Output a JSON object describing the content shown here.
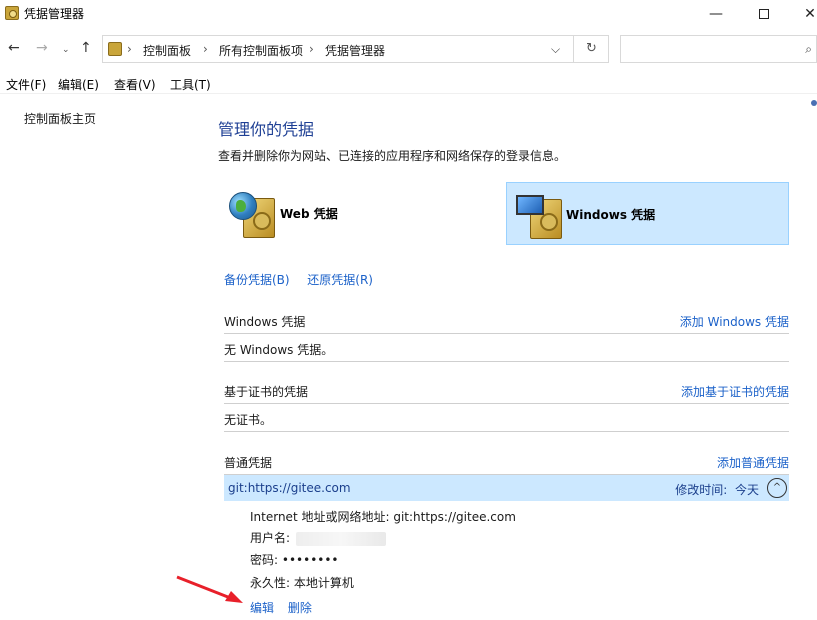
{
  "window": {
    "title": "凭据管理器",
    "minimize_label": "—",
    "close_label": "✕"
  },
  "nav": {
    "back_label": "←",
    "forward_label": "→",
    "recent_label": "⌄",
    "up_label": "↑",
    "breadcrumbs": [
      "控制面板",
      "所有控制面板项",
      "凭据管理器"
    ],
    "separator": "›",
    "dropdown_label": "⌵",
    "refresh_label": "↻",
    "search_placeholder": "",
    "search_label": "⌕"
  },
  "menu": [
    "文件(F)",
    "编辑(E)",
    "查看(V)",
    "工具(T)"
  ],
  "sidebar": {
    "home_link": "控制面板主页"
  },
  "main": {
    "title": "管理你的凭据",
    "description": "查看并删除你为网站、已连接的应用程序和网络保存的登录信息。",
    "cred_types": {
      "web": "Web 凭据",
      "windows": "Windows 凭据",
      "selected": "windows"
    },
    "backup_link": "备份凭据(B)",
    "restore_link": "还原凭据(R)",
    "sections": {
      "windows": {
        "title": "Windows 凭据",
        "action": "添加 Windows 凭据",
        "empty": "无 Windows 凭据。"
      },
      "certificate": {
        "title": "基于证书的凭据",
        "action": "添加基于证书的凭据",
        "empty": "无证书。"
      },
      "generic": {
        "title": "普通凭据",
        "action": "添加普通凭据"
      }
    },
    "credential": {
      "name": "git:https://gitee.com",
      "modified_label": "修改时间:",
      "modified_value": "今天",
      "expand_label": "^",
      "address_label": "Internet 地址或网络地址:",
      "address_value": "git:https://gitee.com",
      "username_label": "用户名:",
      "password_label": "密码:",
      "password_value": "••••••••",
      "persistence_label": "永久性:",
      "persistence_value": "本地计算机",
      "edit_link": "编辑",
      "delete_link": "删除"
    }
  },
  "colors": {
    "link": "#1b61c9",
    "title": "#1e3f94",
    "selected_bg": "#cce8ff",
    "arrow": "#e8202a"
  }
}
